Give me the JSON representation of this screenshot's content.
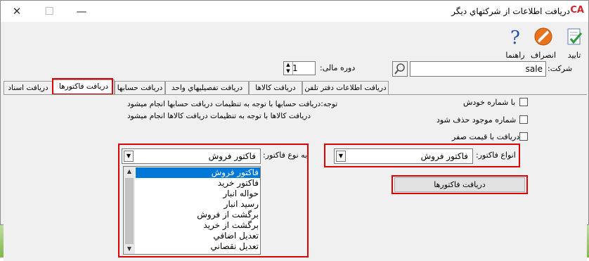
{
  "window": {
    "title": "دريافت اطلاعات از شرکتهاي ديگر",
    "logo": "CA",
    "minimize": "—",
    "maximize": "☐",
    "close": "✕"
  },
  "toolbar": {
    "confirm_label": "تاييد",
    "cancel_label": "انصراف",
    "help_label": "راهنما"
  },
  "form": {
    "company_label": "شرکت:",
    "company_value": "sale",
    "period_label": "دوره مالی:",
    "period_value": "1"
  },
  "tabs": [
    {
      "label": "دریافت اطلاعات دفتر تلفن"
    },
    {
      "label": "دريافت کالاها"
    },
    {
      "label": "دريافت تفصيليهاي واحد"
    },
    {
      "label": "دريافت حسابها"
    },
    {
      "label": "دريافت فاکتورها"
    },
    {
      "label": "دريافت اسناد"
    }
  ],
  "options": {
    "keep_number": "با شماره خودش",
    "delete_existing": "شماره موجود حذف شود",
    "zero_price": "دريافت با قيمت صفر"
  },
  "notes": {
    "line1": "توجه:دريافت حسابها با توجه به تنظيمات دريافت حسابها انجام ميشود",
    "line2": "دريافت کالاها با توجه به تنظيمات دريافت کالاها انجام ميشود"
  },
  "invoice_type": {
    "label": "انواع فاکتور:",
    "value": "فاكتور فروش"
  },
  "target_type": {
    "label": "به نوع فاکتور:",
    "value": "فاكتور فروش",
    "options": [
      "فاكتور فروش",
      "فاكتور خريد",
      "حواله انبار",
      "رسيد انبار",
      "برگشت از فروش",
      "برگشت از خريد",
      "تعديل اضافي",
      "تعديل نقصاني"
    ]
  },
  "receive_button": "دريافت فاکتورها",
  "colors": {
    "highlight": "#e00000",
    "selection": "#0078d7"
  }
}
